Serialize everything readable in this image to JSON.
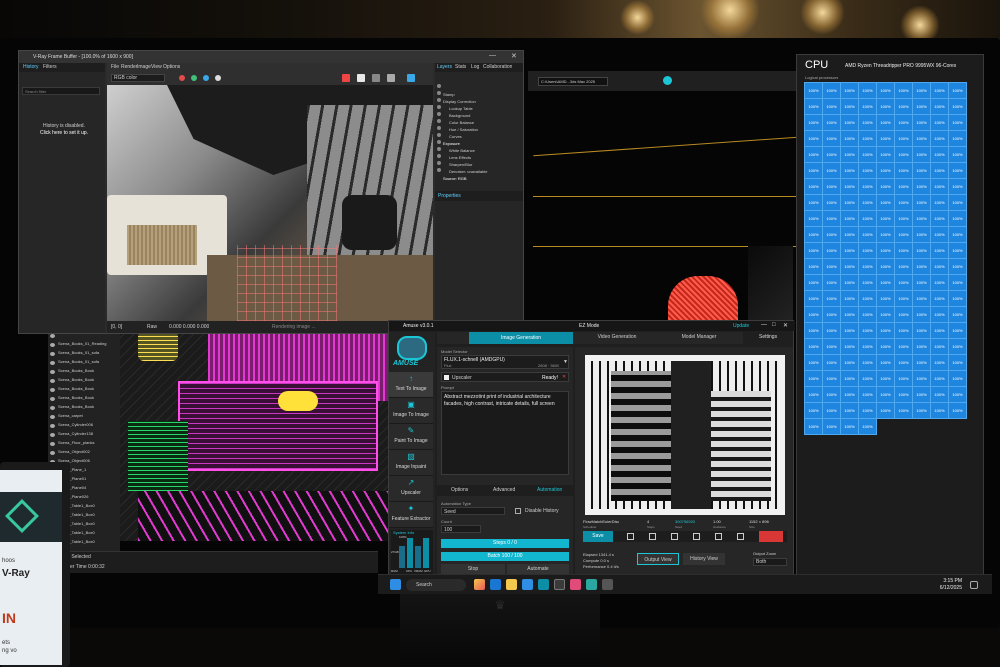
{
  "vray": {
    "window_title": "V-Ray Frame Buffer - [100.0% of 1600 x 900]",
    "menu": [
      "File",
      "Render",
      "Image",
      "View",
      "Options"
    ],
    "channel_select": "RGB color",
    "left_tabs": [
      "History",
      "Filters"
    ],
    "search_placeholder": "Search filter",
    "history_msg": [
      "History is disabled.",
      "Click here to set it up."
    ],
    "right_tabs": [
      "Layers",
      "Stats",
      "Log",
      "Collaboration"
    ],
    "layers": [
      "Stamp",
      "Display Correction",
      "Lookup Table",
      "Background",
      "Color Balance",
      "Hue / Saturation",
      "Curves",
      "Exposure",
      "White Balance",
      "Lens Effects",
      "Sharpen/Blur",
      "Denoiser: unavailable",
      "Source: RGB"
    ],
    "properties_label": "Properties",
    "status_left": "[0, 0]",
    "status_mid": "Raw",
    "status_values": "0.000   0.000   0.000",
    "status_hint": "Rendering image ..."
  },
  "scene": {
    "path": "C:\\Users\\AMD...3ds Max 2025",
    "objects": [
      "Scena_Books_01_Reading",
      "Scena_Books_01_sofa",
      "Scena_Books_01_sofa",
      "Scena_Books_Book",
      "Scena_Books_Book",
      "Scena_Books_Book",
      "Scena_Books_Book",
      "Scena_Books_Book",
      "Scena_carpet",
      "Scena_Cylinder006",
      "Scena_Cylinder138",
      "Scena_Floor_planks",
      "Scena_Object002",
      "Scena_Object006",
      "Scena_Plane_1",
      "Scena_Plane01",
      "Scena_Plane04",
      "Scena_Plane026",
      "Scena_Table1_Box0",
      "Scena_Table1_Box0",
      "Scena_Table1_Box0",
      "Scena_Table1_Box0",
      "Scena_Table1_Box0"
    ],
    "status_selected": "None Selected",
    "render_time": "Render Time  0:00:32"
  },
  "amuse": {
    "title": "Amuse v3.0.1",
    "mode": "EZ Mode",
    "update": "Update",
    "settings": "Settings",
    "main_tabs": [
      "Image Generation",
      "Video Generation",
      "Model Manager"
    ],
    "nav": [
      "Text To Image",
      "Image To Image",
      "Paint To Image",
      "Image Inpaint",
      "Upscaler",
      "Feature Extractor"
    ],
    "brand": "AMUSE",
    "model_selector_label": "Model Selector",
    "model_name": "FLUX.1-schnell (AMDGPU)",
    "model_sub": "Flux",
    "model_size": "2808 · 5600",
    "upscaler_label": "Upscaler",
    "ready": "Ready!",
    "prompt_label": "Prompt",
    "prompt_text": "Abstract mezzotint print of industrial architecture facades, high contrast, intricate details, full screen",
    "sub_tabs": [
      "Options",
      "Advanced",
      "Automation"
    ],
    "automation_type_label": "Automation Type",
    "automation_type_value": "Seed",
    "disable_history": "Disable History",
    "count_label": "Count",
    "count_value": "100",
    "steps_label": "Steps 0 / 0",
    "batch_label": "Batch 100 / 100",
    "stop": "Stop",
    "automate": "Automate",
    "system_info": "System Info",
    "sys_pct": [
      "100%",
      "100%",
      "100%",
      "100%"
    ],
    "sys_vals": [
      "27GB",
      "0GB",
      "31GB"
    ],
    "sys_labels": [
      "RAM",
      "CPU",
      "VRAM",
      "GPU"
    ],
    "meta_headers": [
      "FlowMatchEulerDisc",
      "4",
      "300796920",
      "1.00",
      "1152 × 896"
    ],
    "meta_labels": [
      "Scheduler",
      "Steps",
      "Seed",
      "Guidance",
      "Size"
    ],
    "save": "Save",
    "elapsed": "Elapsed 1341.4 s",
    "compute": "Compute 0.0 s",
    "performance": "Performance 0.4 it/s",
    "output_view": "Output View",
    "history_view": "History View",
    "output_zoom_label": "Output Zoom",
    "output_zoom_value": "Both"
  },
  "cpu": {
    "title": "CPU",
    "model": "AMD Ryzen Threadripper PRO 9995WX 96-Cores",
    "logical_label": "Logical processors",
    "cell_value": "100%",
    "count": 193
  },
  "taskbar": {
    "search": "Search",
    "time": "3:15 PM",
    "date": "6/12/2025"
  },
  "laptop": {
    "line1": "hoos",
    "line2": "V-Ray",
    "line3": "IN",
    "line4": "ets",
    "line5": "ng vo"
  },
  "colors": {
    "accent_teal": "#0c8fa6",
    "cpu_blue": "#1f86e0",
    "wire_magenta": "#e23ad0"
  }
}
